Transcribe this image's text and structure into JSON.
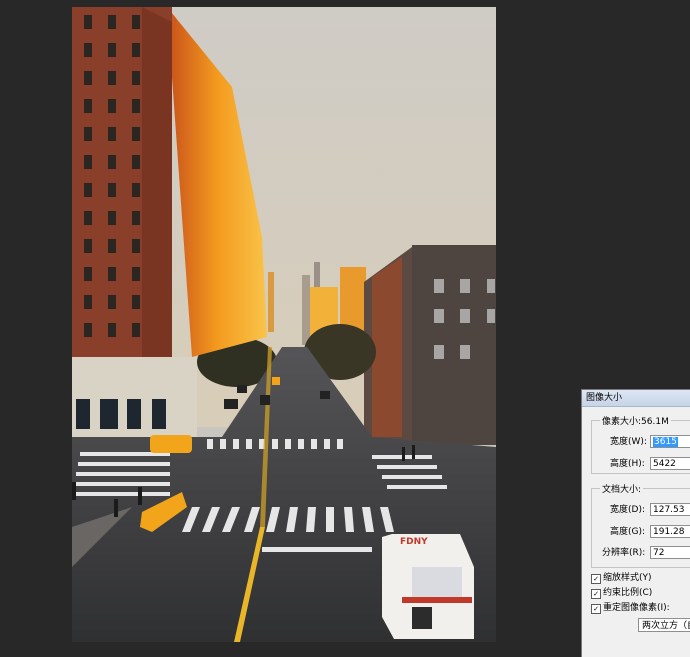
{
  "dialog": {
    "title": "图像大小",
    "pixel_dimensions_label": "像素大小:56.1M",
    "width_label": "宽度(W):",
    "width_value": "3615",
    "height_label": "高度(H):",
    "height_value": "5422",
    "document_size_label": "文档大小:",
    "doc_width_label": "宽度(D):",
    "doc_width_value": "127.53",
    "doc_height_label": "高度(G):",
    "doc_height_value": "191.28",
    "resolution_label": "分辨率(R):",
    "resolution_value": "72",
    "scale_styles_label": "缩放样式(Y)",
    "constrain_label": "约束比例(C)",
    "resample_label": "重定图像像素(I):",
    "resample_method": "两次立方（自",
    "check_mark": "✓"
  },
  "canvas": {
    "ambulance_text": "FDNY"
  },
  "colors": {
    "app_background": "#282828",
    "sky": "#cdc9c2",
    "brick": "#8a3f2a",
    "sunlit": "#e8961e",
    "road": "#3b3b3d",
    "taxi": "#f2a51a"
  }
}
